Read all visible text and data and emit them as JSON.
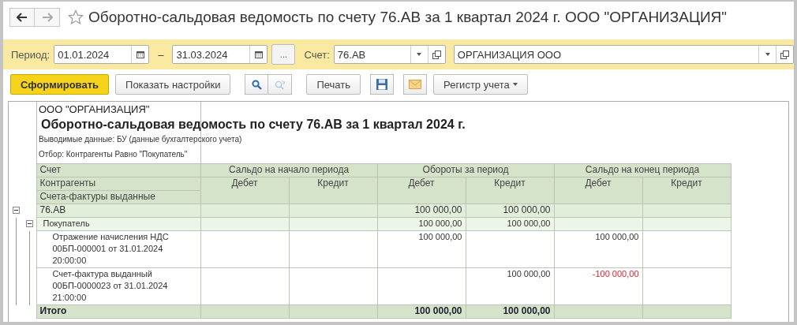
{
  "window": {
    "title": "Оборотно-сальдовая ведомость по счету 76.АВ за 1 квартал 2024 г. ООО \"ОРГАНИЗАЦИЯ\"",
    "favorite": false
  },
  "filters": {
    "period_label": "Период:",
    "date_from": "01.01.2024",
    "dash": "–",
    "date_to": "31.03.2024",
    "more_button": "...",
    "account_label": "Счет:",
    "account": "76.АВ",
    "organization": "ОРГАНИЗАЦИЯ ООО"
  },
  "toolbar": {
    "generate": "Сформировать",
    "settings": "Показать настройки",
    "find_next_disabled": true,
    "print": "Печать",
    "register": "Регистр учета"
  },
  "report": {
    "organization": "ООО \"ОРГАНИЗАЦИЯ\"",
    "title": "Оборотно-сальдовая ведомость по счету 76.АВ за 1 квартал 2024 г.",
    "output_data": "Выводимые данные: БУ (данные бухгалтерского учета)",
    "filter": "Отбор: Контрагенты Равно \"Покупатель\"",
    "hierarchy_headers": [
      "Счет",
      "Контрагенты",
      "Счета-фактуры выданные"
    ],
    "column_groups": [
      {
        "label": "Сальдо на начало периода",
        "columns": [
          "Дебет",
          "Кредит"
        ]
      },
      {
        "label": "Обороты за период",
        "columns": [
          "Дебет",
          "Кредит"
        ]
      },
      {
        "label": "Сальдо на конец периода",
        "columns": [
          "Дебет",
          "Кредит"
        ]
      }
    ],
    "rows": [
      {
        "label": "76.АВ",
        "expanded": true,
        "values": {
          "turnover_debit": {
            "text": "100 000,00",
            "negative": false
          },
          "turnover_credit": {
            "text": "100 000,00",
            "negative": false
          }
        },
        "children": [
          {
            "label": "Покупатель",
            "expanded": true,
            "values": {
              "turnover_debit": {
                "text": "100 000,00",
                "negative": false
              },
              "turnover_credit": {
                "text": "100 000,00",
                "negative": false
              }
            },
            "children": [
              {
                "label": "Отражение начисления НДС 00БП-000001 от 31.01.2024 20:00:00",
                "values": {
                  "turnover_debit": {
                    "text": "100 000,00",
                    "negative": false
                  },
                  "closing_debit": {
                    "text": "100 000,00",
                    "negative": false
                  }
                }
              },
              {
                "label": "Счет-фактура выданный 00БП-0000023 от 31.01.2024 21:00:00",
                "values": {
                  "turnover_credit": {
                    "text": "100 000,00",
                    "negative": false
                  },
                  "closing_debit": {
                    "text": "-100 000,00",
                    "negative": true
                  }
                }
              }
            ]
          }
        ]
      }
    ],
    "total": {
      "label": "Итого",
      "values": {
        "turnover_debit": {
          "text": "100 000,00",
          "negative": false
        },
        "turnover_credit": {
          "text": "100 000,00",
          "negative": false
        }
      }
    }
  }
}
